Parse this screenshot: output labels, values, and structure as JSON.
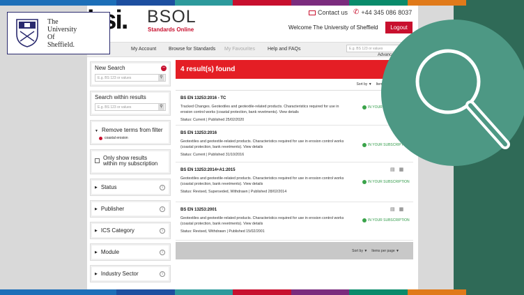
{
  "colors": {
    "brand_red": "#c8102e",
    "header_red": "#e41e25",
    "green_panel": "#2f6a57",
    "circle_green": "#4d9884",
    "subscription_green": "#2f9a47"
  },
  "stripe_colors": [
    "#1d6fb8",
    "#1d6fb8",
    "#1d4fa0",
    "#2d9a9c",
    "#c8102e",
    "#7b2c7e",
    "#0a8b6b",
    "#e07a1a",
    "#2f6a57"
  ],
  "university_logo": {
    "lines": [
      "The",
      "University",
      "Of",
      "Sheffield."
    ]
  },
  "header": {
    "bsi_logo": "bsi.",
    "product_name": "BSOL",
    "product_sub": "Standards Online",
    "contact_label": "Contact us",
    "phone": "+44 345 086 8037",
    "welcome": "Welcome The University of Sheffield",
    "logout_label": "Logout"
  },
  "nav": {
    "items": [
      "My Account",
      "Browse for Standards",
      "My Favourites",
      "Help and FAQs"
    ],
    "search_placeholder": "E.g. BS 123 or values",
    "advanced": "Advanced"
  },
  "sidebar": {
    "new_search": {
      "title": "New Search",
      "placeholder": "E.g. BS 123 or values"
    },
    "search_within": {
      "title": "Search within results",
      "placeholder": "E.g. BS 123 or values"
    },
    "remove_terms": {
      "title": "Remove terms from filter",
      "term": "coastal erosion"
    },
    "subscription_filter": {
      "line1": "Only show results",
      "line2": "within my subscription"
    },
    "facets": [
      "Status",
      "Publisher",
      "ICS Category",
      "Module",
      "Industry Sector"
    ]
  },
  "results": {
    "count_label": "4 result(s) found",
    "sort_label": "Sort by",
    "per_page_label": "Items per page",
    "subscription_label": "IN YOUR SUBSCRIPTION",
    "items": [
      {
        "title": "BS EN 13253:2016 - TC",
        "desc": "Tracked Changes. Geotextiles and geotextile-related products. Characteristics required for use in erosion control works (coastal protection, bank revetments).",
        "view": "View details",
        "status": "Status: Current",
        "published": "Published 25/02/2020"
      },
      {
        "title": "BS EN 13253:2016",
        "desc": "Geotextiles and geotextile-related products. Characteristics required for use in erosion control works (coastal protection, bank revetments).",
        "view": "View details",
        "status": "Status: Current",
        "published": "Published 31/10/2016"
      },
      {
        "title": "BS EN 13253:2014+A1:2015",
        "desc": "Geotextiles and geotextile-related products. Characteristics required for use in erosion control works (coastal protection, bank revetments).",
        "view": "View details",
        "status": "Status: Revised, Superseded, Withdrawn",
        "published": "Published 28/02/2014"
      },
      {
        "title": "BS EN 13253:2001",
        "desc": "Geotextiles and geotextile-related products. Characteristics required for use in erosion control works (coastal protection, bank revetments).",
        "view": "View details",
        "status": "Status: Revised, Withdrawn",
        "published": "Published 15/02/2001"
      }
    ]
  }
}
